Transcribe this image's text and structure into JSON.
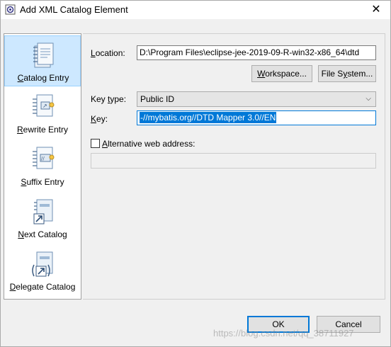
{
  "window": {
    "title": "Add XML Catalog Element",
    "close_symbol": "✕"
  },
  "sidebar": {
    "items": [
      {
        "label_mnemonic": "C",
        "label_rest": "atalog Entry",
        "icon": "catalog-entry-icon",
        "selected": true
      },
      {
        "label_mnemonic": "R",
        "label_rest": "ewrite Entry",
        "icon": "rewrite-entry-icon",
        "selected": false
      },
      {
        "label_mnemonic": "S",
        "label_rest": "uffix Entry",
        "icon": "suffix-entry-icon",
        "selected": false
      },
      {
        "label_mnemonic": "N",
        "label_rest": "ext Catalog",
        "icon": "next-catalog-icon",
        "selected": false
      },
      {
        "label_mnemonic": "D",
        "label_rest": "elegate Catalog",
        "icon": "delegate-catalog-icon",
        "selected": false
      }
    ]
  },
  "form": {
    "location_label_mnemonic": "L",
    "location_label_rest": "ocation:",
    "location_value": "D:\\Program Files\\eclipse-jee-2019-09-R-win32-x86_64\\dtd",
    "workspace_button_mnemonic": "W",
    "workspace_button_rest": "orkspace...",
    "filesystem_button_pre": "File S",
    "filesystem_button_mnemonic": "y",
    "filesystem_button_rest": "stem...",
    "keytype_label_pre": "Key ",
    "keytype_label_mnemonic": "t",
    "keytype_label_rest": "ype:",
    "keytype_value": "Public ID",
    "key_label_mnemonic": "K",
    "key_label_rest": "ey:",
    "key_value": "-//mybatis.org//DTD Mapper 3.0//EN",
    "alt_checkbox_checked": false,
    "alt_label_mnemonic": "A",
    "alt_label_rest": "lternative web address:",
    "alt_value": ""
  },
  "footer": {
    "ok_label": "OK",
    "cancel_label": "Cancel"
  },
  "watermark": "https://blog.csdn.net/qq_38711927",
  "colors": {
    "selection_bg": "#cde8ff",
    "text_selection": "#0078d7",
    "dialog_bg": "#f0f0f0"
  }
}
